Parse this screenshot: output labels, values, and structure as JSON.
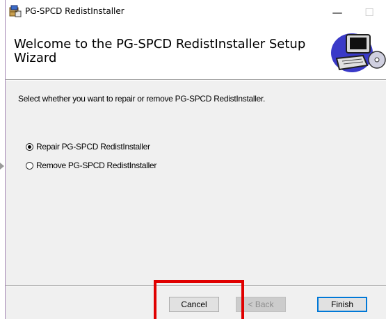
{
  "window": {
    "title": "PG-SPCD RedistInstaller",
    "minimize_glyph": "—",
    "maximize_glyph": "☐",
    "close_glyph": "✕"
  },
  "header": {
    "title": "Welcome to the PG-SPCD RedistInstaller Setup Wizard",
    "art_icon": "computer-cd-icon"
  },
  "main": {
    "prompt": "Select whether you want to repair or remove PG-SPCD RedistInstaller.",
    "options": [
      {
        "label": "Repair PG-SPCD RedistInstaller",
        "selected": true
      },
      {
        "label": "Remove PG-SPCD RedistInstaller",
        "selected": false
      }
    ]
  },
  "buttons": {
    "cancel": "Cancel",
    "back": "< Back",
    "finish": "Finish"
  },
  "colors": {
    "highlight": "#e00000",
    "default_button_border": "#0078d7"
  }
}
